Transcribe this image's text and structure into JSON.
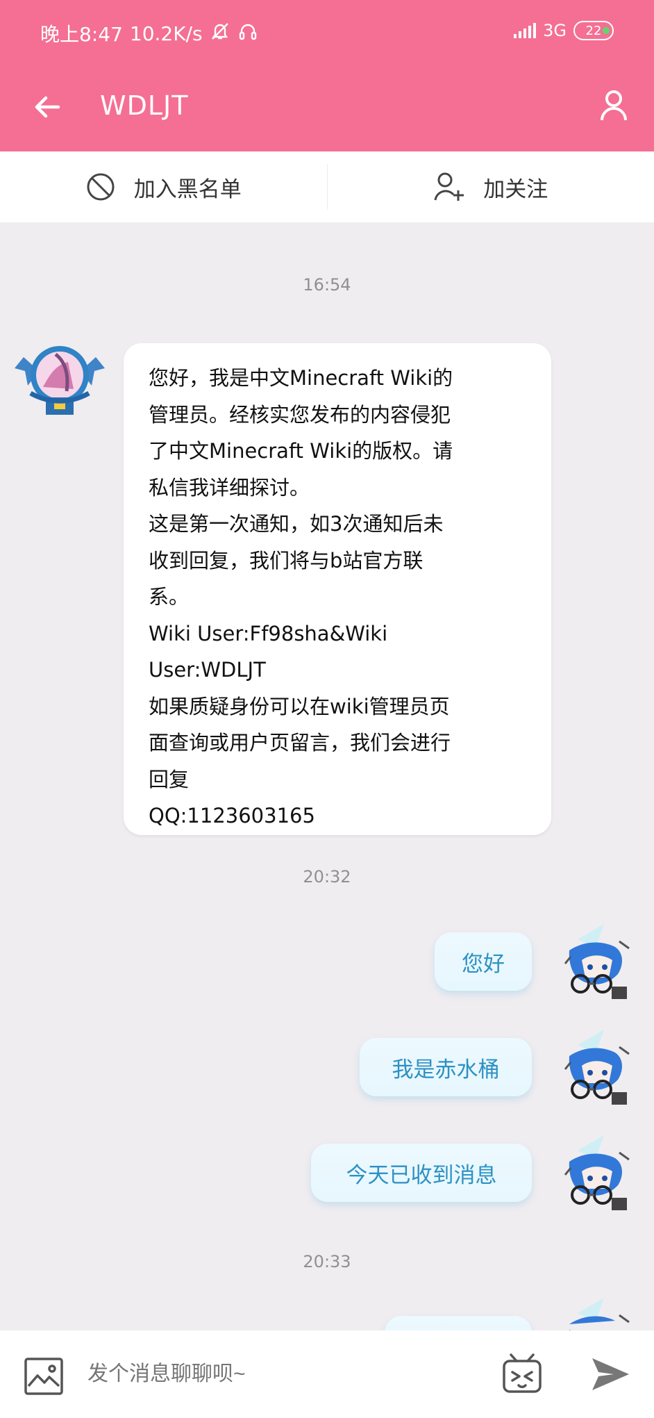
{
  "status_bar": {
    "time": "晚上8:47",
    "speed": "10.2K/s",
    "network": "3G",
    "battery": "22"
  },
  "header": {
    "title": "WDLJT"
  },
  "actions": {
    "blacklist_label": "加入黑名单",
    "follow_label": "加关注"
  },
  "chat": {
    "times": [
      "16:54",
      "20:32",
      "20:33"
    ],
    "incoming_message": "您好，我是中文Minecraft Wiki的\n管理员。经核实您发布的内容侵犯\n了中文Minecraft Wiki的版权。请\n私信我详细探讨。\n这是第一次通知，如3次通知后未\n收到回复，我们将与b站官方联\n系。\nWiki User:Ff98sha&Wiki\nUser:WDLJT\n如果质疑身份可以在wiki管理员页\n面查询或用户页留言，我们会进行\n回复\nQQ:1123603165",
    "outgoing_messages": [
      "您好",
      "我是赤水桶",
      "今天已收到消息"
    ]
  },
  "input": {
    "placeholder": "发个消息聊聊呗~"
  },
  "icons": {
    "back": "arrow-left-icon",
    "profile": "user-icon",
    "blacklist": "ban-icon",
    "follow": "add-user-icon",
    "image": "image-icon",
    "emoji": "bilibili-emoji-icon",
    "send": "send-icon"
  },
  "colors": {
    "brand": "#f46f93",
    "bubble_text": "#2d91c4",
    "background": "#f0edf0"
  }
}
